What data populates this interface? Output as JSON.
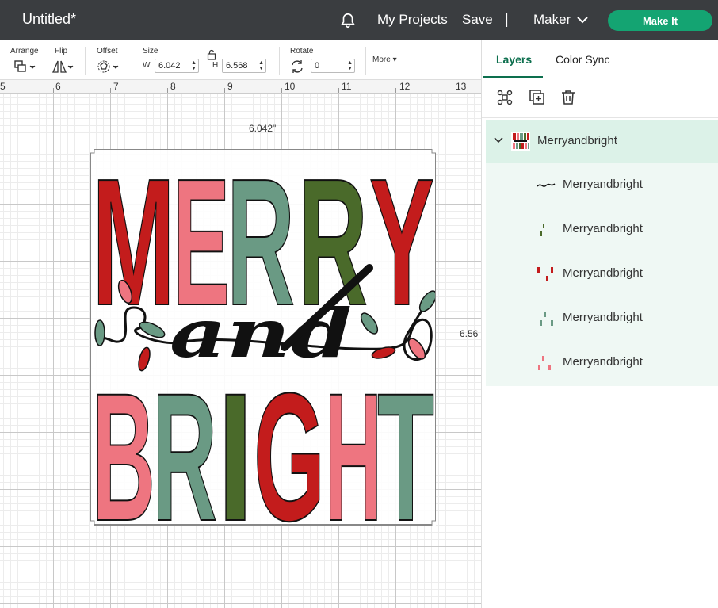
{
  "header": {
    "doc_title": "Untitled*",
    "my_projects": "My Projects",
    "save": "Save",
    "separator": "|",
    "machine": "Maker",
    "make_it": "Make It"
  },
  "toolbar": {
    "arrange": "Arrange",
    "flip": "Flip",
    "offset": "Offset",
    "size": "Size",
    "width_letter": "W",
    "width_value": "6.042",
    "height_letter": "H",
    "height_value": "6.568",
    "rotate": "Rotate",
    "rotate_value": "0",
    "more": "More"
  },
  "ruler": [
    "5",
    "6",
    "7",
    "8",
    "9",
    "10",
    "11",
    "12",
    "13"
  ],
  "canvas": {
    "width_label": "6.042\"",
    "height_label": "6.56"
  },
  "design": {
    "line1": [
      "M",
      "E",
      "R",
      "R",
      "Y"
    ],
    "line2": "and",
    "line3": [
      "B",
      "R",
      "I",
      "G",
      "H",
      "T"
    ],
    "colors": {
      "red": "#c31c1c",
      "pink": "#ee7580",
      "sage": "#6a9a84",
      "olive": "#4a6a2a"
    }
  },
  "panel": {
    "tabs": [
      "Layers",
      "Color Sync"
    ],
    "group_name": "Merryandbright",
    "layers": [
      "Merryandbright",
      "Merryandbright",
      "Merryandbright",
      "Merryandbright",
      "Merryandbright"
    ]
  },
  "icons": {
    "bell": "bell-icon",
    "chevron": "chevron-down-icon",
    "group": "group-icon",
    "duplicate": "duplicate-icon",
    "delete": "trash-icon",
    "lock": "lock-icon"
  },
  "accent": "#14a472"
}
